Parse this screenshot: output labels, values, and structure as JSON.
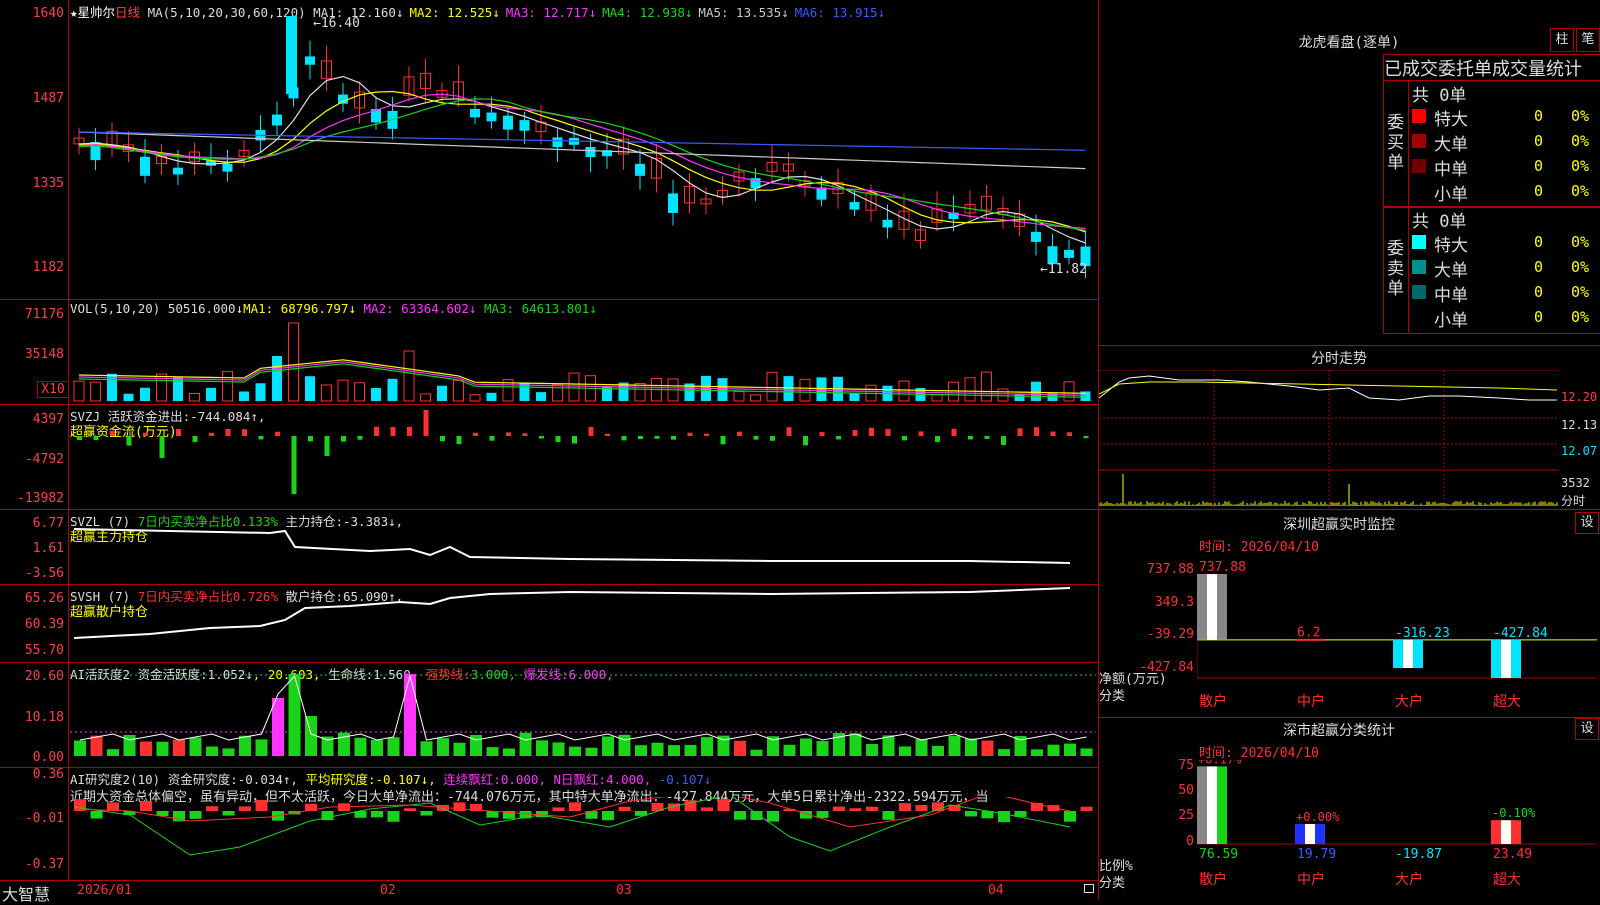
{
  "stock": {
    "star": "★",
    "name": "星帅尔",
    "period": "日线",
    "ma_header": "MA(5,10,20,30,60,120)",
    "ma_values": [
      {
        "label": "MA1:",
        "value": "12.160↓",
        "color": "#dddddd"
      },
      {
        "label": "MA2:",
        "value": "12.525↓",
        "color": "#ffff00"
      },
      {
        "label": "MA3:",
        "value": "12.717↓",
        "color": "#ff33ff"
      },
      {
        "label": "MA4:",
        "value": "12.938↓",
        "color": "#19d419"
      },
      {
        "label": "MA5:",
        "value": "13.535↓",
        "color": "#cccccc"
      },
      {
        "label": "MA6:",
        "value": "13.915↓",
        "color": "#3a5bff"
      }
    ],
    "high_marker": "16.40",
    "low_marker": "11.82",
    "price_axis": [
      "1640",
      "1487",
      "1335",
      "1182"
    ]
  },
  "vol_pane": {
    "header": "VOL(5,10,20)",
    "value": "50516.000↓",
    "ma1": "MA1: 68796.797↓",
    "ma2": "MA2: 63364.602↓",
    "ma3": "MA3: 64613.801↓",
    "axis": [
      "71176",
      "35148"
    ],
    "unit_badge": "X10"
  },
  "svzj_pane": {
    "header": "SVZJ",
    "label": "活跃资金进出:",
    "value": "-744.084↑,",
    "sub": "超赢资金流(万元)",
    "axis": [
      "4397",
      "-4792",
      "-13982"
    ]
  },
  "svzl_pane": {
    "header": "SVZL (7)",
    "label1": "7日内买卖净占比0.133%",
    "label2": "主力持仓:",
    "value2": "-3.383↓,",
    "sub": "超赢主力持仓",
    "axis": [
      "6.77",
      "1.61",
      "-3.56"
    ]
  },
  "svsh_pane": {
    "header": "SVSH (7)",
    "label1": "7日内买卖净占比0.726%",
    "label2": "散户持仓:",
    "value2": "65.090↑,",
    "sub": "超赢散户持仓",
    "axis": [
      "65.26",
      "60.39",
      "55.70"
    ]
  },
  "ai_active_pane": {
    "header": "AI活跃度2",
    "l1": "资金活跃度:",
    "v1": "1.052↓,",
    "v2": "20.603,",
    "l3": "生命线:",
    "v3": "1.560,",
    "l4": "强势线:",
    "v4": "3.000,",
    "l5": "爆发线:",
    "v5": "6.000,",
    "axis": [
      "20.60",
      "10.18",
      "0.00"
    ]
  },
  "ai_research_pane": {
    "header": "AI研究度2(10)",
    "l1": "资金研究度:",
    "v1": "-0.034↑,",
    "l2": "平均研究度:",
    "v2": "-0.107↓,",
    "l3": "连续飘红:",
    "v3": "0.000,",
    "l4": "N日飘红:",
    "v4": "4.000,",
    "v5": "-0.107↓",
    "commentary": "近期大资金总体偏空，虽有异动，但不太活跃，今日大单净流出：-744.076万元，其中特大单净流出：-427.844万元，大单5日累计净出-2322.594万元，当",
    "axis": [
      "0.36",
      "-0.01",
      "-0.37"
    ]
  },
  "footer": {
    "brand": "大智慧",
    "dates": [
      "2026/01",
      "02",
      "03",
      "04"
    ]
  },
  "dragon_tiger": {
    "title": "龙虎看盘(逐单)",
    "btn_bar": "柱",
    "btn_order": "笔",
    "subtitle": "已成交委托单成交量统计",
    "buy_side": "委买单",
    "sell_side": "委卖单",
    "buy_total": "共 0单",
    "sell_total": "共 0单",
    "buy_rows": [
      {
        "label": "特大",
        "qty": "0",
        "pct": "0%",
        "color": "#ff0000"
      },
      {
        "label": "大单",
        "qty": "0",
        "pct": "0%",
        "color": "#a00000"
      },
      {
        "label": "中单",
        "qty": "0",
        "pct": "0%",
        "color": "#700000"
      },
      {
        "label": "小单",
        "qty": "0",
        "pct": "0%",
        "color": "#000000"
      }
    ],
    "sell_rows": [
      {
        "label": "特大",
        "qty": "0",
        "pct": "0%",
        "color": "#00ffff"
      },
      {
        "label": "大单",
        "qty": "0",
        "pct": "0%",
        "color": "#008f8f"
      },
      {
        "label": "中单",
        "qty": "0",
        "pct": "0%",
        "color": "#006a6a"
      },
      {
        "label": "小单",
        "qty": "0",
        "pct": "0%",
        "color": "#000000"
      }
    ]
  },
  "intraday": {
    "title": "分时走势",
    "axis": [
      "12.20",
      "12.13",
      "12.07"
    ],
    "vol_label": "3532",
    "vol_unit": "分时"
  },
  "sz_monitor": {
    "title": "深圳超赢实时监控",
    "setting_btn": "设",
    "time": "时间: 2026/04/10",
    "axis": [
      "737.88",
      "349.3",
      "-39.29",
      "-427.84"
    ],
    "ylabel_1": "净额(万元)",
    "ylabel_2": "分类",
    "categories": [
      "散户",
      "中户",
      "大户",
      "超大"
    ],
    "values": [
      737.88,
      6.2,
      -316.23,
      -427.84
    ],
    "value_labels": [
      "737.88",
      "6.2",
      "-316.23",
      "-427.84"
    ]
  },
  "sz_class": {
    "title": "深市超赢分类统计",
    "setting_btn": "设",
    "time": "时间: 2026/04/10",
    "axis": [
      "75",
      "50",
      "25",
      "0"
    ],
    "ylabel_1": "比例%",
    "ylabel_2": "分类",
    "categories": [
      "散户",
      "中户",
      "大户",
      "超大"
    ],
    "values": [
      76.59,
      19.79,
      -19.87,
      23.49
    ],
    "value_labels": [
      "76.59",
      "19.79",
      "-19.87",
      "23.49"
    ],
    "change_labels": [
      "+0.17%",
      "+0.00%",
      "",
      "-0.10%"
    ]
  },
  "colors": {
    "grid": "#b00000",
    "up": "#ff3030",
    "down": "#00e5ff",
    "ma_yellow": "#ffff00",
    "ma_magenta": "#ff33ff",
    "ma_green": "#19d419",
    "ma_blue": "#3a5bff"
  }
}
